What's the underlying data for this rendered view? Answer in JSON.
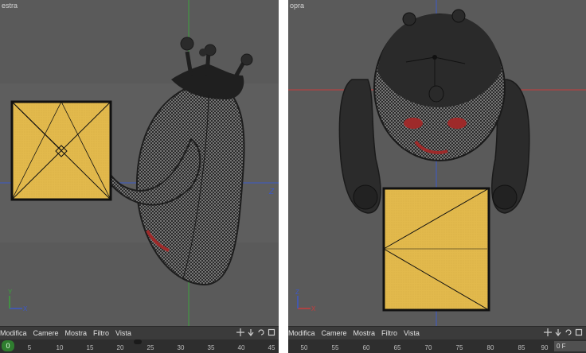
{
  "left_view": {
    "label": "estra",
    "menu": [
      "Modifica",
      "Camere",
      "Mostra",
      "Filtro",
      "Vista"
    ],
    "ruler": {
      "frame_badge": "0",
      "ticks": [
        "5",
        "10",
        "15",
        "20",
        "25",
        "30",
        "35",
        "40",
        "45"
      ]
    },
    "axis_labels": {
      "z": "Z",
      "y": "Y",
      "x": "X"
    }
  },
  "right_view": {
    "label": "opra",
    "menu": [
      "Modifica",
      "Camere",
      "Mostra",
      "Filtro",
      "Vista"
    ],
    "ruler": {
      "ticks": [
        "50",
        "55",
        "60",
        "65",
        "70",
        "75",
        "80",
        "85",
        "90"
      ],
      "field_value": "0 F"
    },
    "axis_labels": {
      "z": "Z",
      "x": "X"
    }
  },
  "colors": {
    "viewport_bg": "#5a5a5a",
    "axis_green": "#3da13d",
    "axis_blue": "#3c59c8",
    "axis_red": "#c83c3c",
    "box_yellow": "#e2b94c",
    "mesh_dark": "#2b2b2b"
  },
  "icons": [
    "move-icon",
    "arrow-down-icon",
    "rotate-icon",
    "square-icon"
  ]
}
